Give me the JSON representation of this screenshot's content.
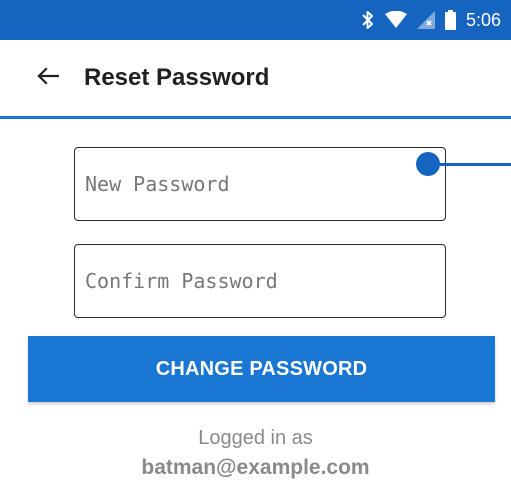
{
  "status_bar": {
    "time": "5:06",
    "icons": [
      "bluetooth-icon",
      "wifi-icon",
      "signal-icon",
      "battery-icon"
    ],
    "background": "#1565c0"
  },
  "app_bar": {
    "title": "Reset Password",
    "back_icon": "arrow-left-icon"
  },
  "form": {
    "new_password": {
      "value": "",
      "placeholder": "New Password"
    },
    "confirm_password": {
      "value": "",
      "placeholder": "Confirm Password"
    },
    "submit_label": "CHANGE PASSWORD"
  },
  "footer": {
    "logged_in_label": "Logged in as",
    "email": "batman@example.com"
  },
  "colors": {
    "accent": "#1976d2",
    "primary_dark": "#1565c0",
    "muted_text": "#8a8a8a"
  }
}
